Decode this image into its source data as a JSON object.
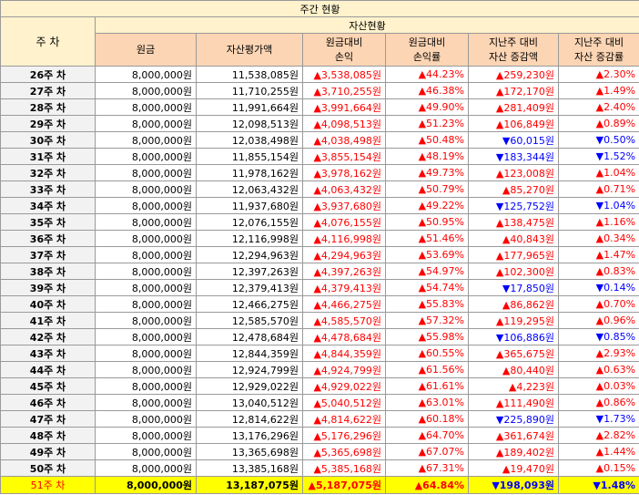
{
  "title": "주간 현황",
  "header": {
    "week_label": "주 차",
    "group_label": "자산현황",
    "columns": [
      "원금",
      "자산평가액",
      "원금대비\n손익",
      "원금대비\n손익률",
      "지난주 대비\n자산 증감액",
      "지난주 대비\n자산 증감률"
    ]
  },
  "up_symbol": "▲",
  "down_symbol": "▼",
  "rows": [
    {
      "week": "26주 차",
      "principal": "8,000,000원",
      "value": "11,538,085원",
      "pl": "3,538,085원",
      "plr": "44.23%",
      "chg": "259,230원",
      "chg_dir": "up",
      "chgr": "2.30%",
      "hl": false
    },
    {
      "week": "27주 차",
      "principal": "8,000,000원",
      "value": "11,710,255원",
      "pl": "3,710,255원",
      "plr": "46.38%",
      "chg": "172,170원",
      "chg_dir": "up",
      "chgr": "1.49%",
      "hl": false
    },
    {
      "week": "28주 차",
      "principal": "8,000,000원",
      "value": "11,991,664원",
      "pl": "3,991,664원",
      "plr": "49.90%",
      "chg": "281,409원",
      "chg_dir": "up",
      "chgr": "2.40%",
      "hl": false
    },
    {
      "week": "29주 차",
      "principal": "8,000,000원",
      "value": "12,098,513원",
      "pl": "4,098,513원",
      "plr": "51.23%",
      "chg": "106,849원",
      "chg_dir": "up",
      "chgr": "0.89%",
      "hl": false
    },
    {
      "week": "30주 차",
      "principal": "8,000,000원",
      "value": "12,038,498원",
      "pl": "4,038,498원",
      "plr": "50.48%",
      "chg": "60,015원",
      "chg_dir": "down",
      "chgr": "0.50%",
      "hl": false
    },
    {
      "week": "31주 차",
      "principal": "8,000,000원",
      "value": "11,855,154원",
      "pl": "3,855,154원",
      "plr": "48.19%",
      "chg": "183,344원",
      "chg_dir": "down",
      "chgr": "1.52%",
      "hl": false
    },
    {
      "week": "32주 차",
      "principal": "8,000,000원",
      "value": "11,978,162원",
      "pl": "3,978,162원",
      "plr": "49.73%",
      "chg": "123,008원",
      "chg_dir": "up",
      "chgr": "1.04%",
      "hl": false
    },
    {
      "week": "33주 차",
      "principal": "8,000,000원",
      "value": "12,063,432원",
      "pl": "4,063,432원",
      "plr": "50.79%",
      "chg": "85,270원",
      "chg_dir": "up",
      "chgr": "0.71%",
      "hl": false
    },
    {
      "week": "34주 차",
      "principal": "8,000,000원",
      "value": "11,937,680원",
      "pl": "3,937,680원",
      "plr": "49.22%",
      "chg": "125,752원",
      "chg_dir": "down",
      "chgr": "1.04%",
      "hl": false
    },
    {
      "week": "35주 차",
      "principal": "8,000,000원",
      "value": "12,076,155원",
      "pl": "4,076,155원",
      "plr": "50.95%",
      "chg": "138,475원",
      "chg_dir": "up",
      "chgr": "1.16%",
      "hl": false
    },
    {
      "week": "36주 차",
      "principal": "8,000,000원",
      "value": "12,116,998원",
      "pl": "4,116,998원",
      "plr": "51.46%",
      "chg": "40,843원",
      "chg_dir": "up",
      "chgr": "0.34%",
      "hl": false
    },
    {
      "week": "37주 차",
      "principal": "8,000,000원",
      "value": "12,294,963원",
      "pl": "4,294,963원",
      "plr": "53.69%",
      "chg": "177,965원",
      "chg_dir": "up",
      "chgr": "1.47%",
      "hl": false
    },
    {
      "week": "38주 차",
      "principal": "8,000,000원",
      "value": "12,397,263원",
      "pl": "4,397,263원",
      "plr": "54.97%",
      "chg": "102,300원",
      "chg_dir": "up",
      "chgr": "0.83%",
      "hl": false
    },
    {
      "week": "39주 차",
      "principal": "8,000,000원",
      "value": "12,379,413원",
      "pl": "4,379,413원",
      "plr": "54.74%",
      "chg": "17,850원",
      "chg_dir": "down",
      "chgr": "0.14%",
      "hl": false
    },
    {
      "week": "40주 차",
      "principal": "8,000,000원",
      "value": "12,466,275원",
      "pl": "4,466,275원",
      "plr": "55.83%",
      "chg": "86,862원",
      "chg_dir": "up",
      "chgr": "0.70%",
      "hl": false
    },
    {
      "week": "41주 차",
      "principal": "8,000,000원",
      "value": "12,585,570원",
      "pl": "4,585,570원",
      "plr": "57.32%",
      "chg": "119,295원",
      "chg_dir": "up",
      "chgr": "0.96%",
      "hl": false
    },
    {
      "week": "42주 차",
      "principal": "8,000,000원",
      "value": "12,478,684원",
      "pl": "4,478,684원",
      "plr": "55.98%",
      "chg": "106,886원",
      "chg_dir": "down",
      "chgr": "0.85%",
      "hl": false
    },
    {
      "week": "43주 차",
      "principal": "8,000,000원",
      "value": "12,844,359원",
      "pl": "4,844,359원",
      "plr": "60.55%",
      "chg": "365,675원",
      "chg_dir": "up",
      "chgr": "2.93%",
      "hl": false
    },
    {
      "week": "44주 차",
      "principal": "8,000,000원",
      "value": "12,924,799원",
      "pl": "4,924,799원",
      "plr": "61.56%",
      "chg": "80,440원",
      "chg_dir": "up",
      "chgr": "0.63%",
      "hl": false
    },
    {
      "week": "45주 차",
      "principal": "8,000,000원",
      "value": "12,929,022원",
      "pl": "4,929,022원",
      "plr": "61.61%",
      "chg": "4,223원",
      "chg_dir": "up",
      "chgr": "0.03%",
      "hl": false
    },
    {
      "week": "46주 차",
      "principal": "8,000,000원",
      "value": "13,040,512원",
      "pl": "5,040,512원",
      "plr": "63.01%",
      "chg": "111,490원",
      "chg_dir": "up",
      "chgr": "0.86%",
      "hl": false
    },
    {
      "week": "47주 차",
      "principal": "8,000,000원",
      "value": "12,814,622원",
      "pl": "4,814,622원",
      "plr": "60.18%",
      "chg": "225,890원",
      "chg_dir": "down",
      "chgr": "1.73%",
      "hl": false
    },
    {
      "week": "48주 차",
      "principal": "8,000,000원",
      "value": "13,176,296원",
      "pl": "5,176,296원",
      "plr": "64.70%",
      "chg": "361,674원",
      "chg_dir": "up",
      "chgr": "2.82%",
      "hl": false
    },
    {
      "week": "49주 차",
      "principal": "8,000,000원",
      "value": "13,365,698원",
      "pl": "5,365,698원",
      "plr": "67.07%",
      "chg": "189,402원",
      "chg_dir": "up",
      "chgr": "1.44%",
      "hl": false
    },
    {
      "week": "50주 차",
      "principal": "8,000,000원",
      "value": "13,385,168원",
      "pl": "5,385,168원",
      "plr": "67.31%",
      "chg": "19,470원",
      "chg_dir": "up",
      "chgr": "0.15%",
      "hl": false
    },
    {
      "week": "51주 차",
      "principal": "8,000,000원",
      "value": "13,187,075원",
      "pl": "5,187,075원",
      "plr": "64.84%",
      "chg": "198,093원",
      "chg_dir": "down",
      "chgr": "1.48%",
      "hl": true
    }
  ]
}
